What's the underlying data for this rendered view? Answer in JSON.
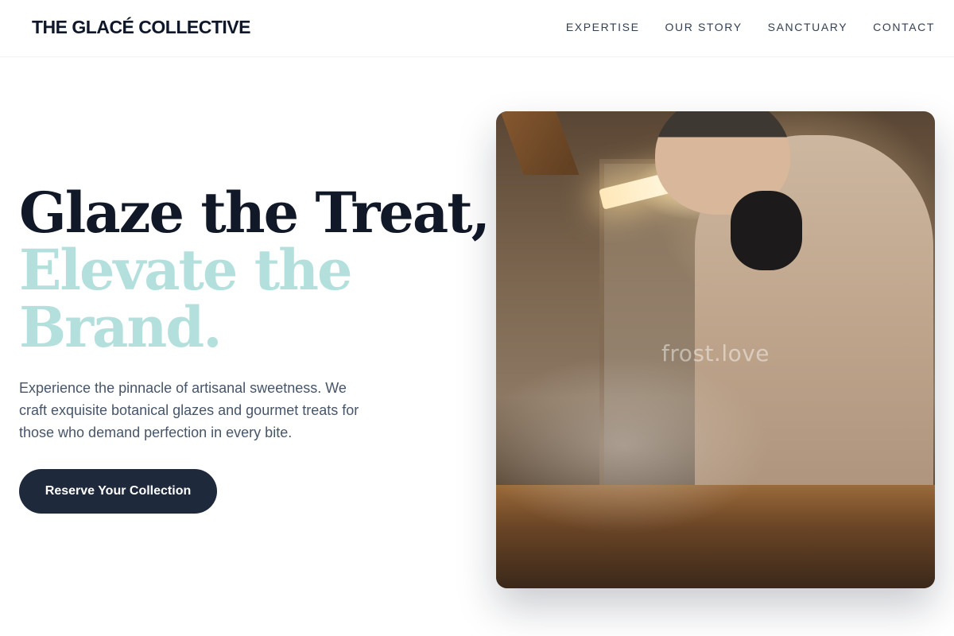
{
  "header": {
    "brand": "THE GLACÉ COLLECTIVE",
    "nav": [
      "EXPERTISE",
      "OUR STORY",
      "SANCTUARY",
      "CONTACT"
    ]
  },
  "hero": {
    "title_line1": "Glaze the Treat,",
    "title_line2": "Elevate the Brand.",
    "lead": "Experience the pinnacle of artisanal sweetness. We craft exquisite botanical glazes and gourmet treats for those who demand perfection in every bite.",
    "cta_label": "Reserve Your Collection"
  },
  "image": {
    "watermark": "frost.love"
  },
  "colors": {
    "dark": "#111827",
    "accent": "#b3e0dc",
    "button": "#1e293b"
  }
}
